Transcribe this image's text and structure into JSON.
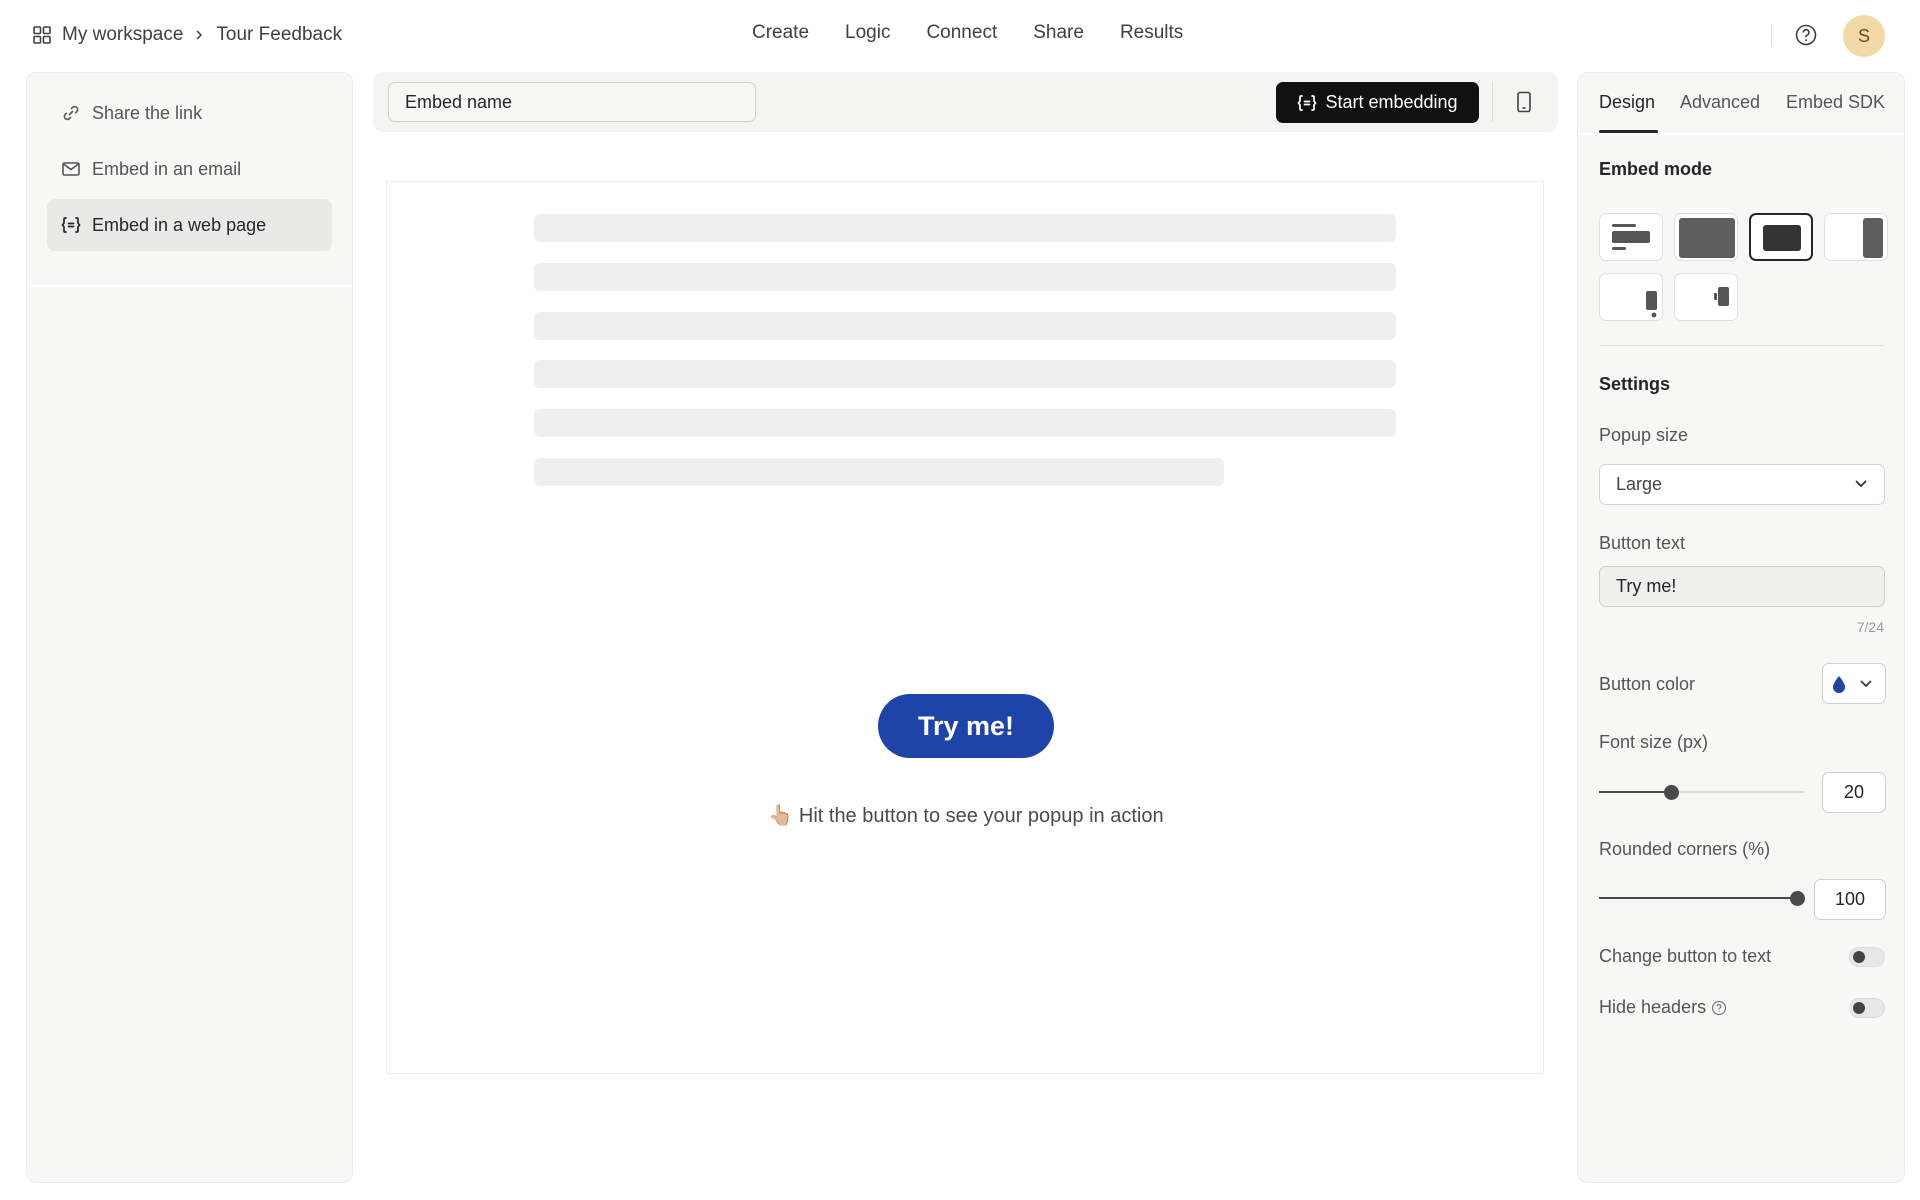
{
  "breadcrumb": {
    "workspace": "My workspace",
    "form": "Tour Feedback"
  },
  "topnav": [
    "Create",
    "Logic",
    "Connect",
    "Share",
    "Results"
  ],
  "avatar": {
    "initial": "S",
    "color": "#f3d9a7"
  },
  "left_menu": [
    {
      "label": "Share the link",
      "icon": "link-icon"
    },
    {
      "label": "Embed in an email",
      "icon": "mail-icon"
    },
    {
      "label": "Embed in a web page",
      "icon": "embed-code-icon",
      "active": true
    }
  ],
  "embed_bar": {
    "name_value": "Embed name",
    "start_label": "Start embedding",
    "device_icon": "mobile-device-icon"
  },
  "preview": {
    "button_label": "Try me!",
    "hint": "👆🏼 Hit the button to see your popup in action",
    "button_color": "#1f44a9"
  },
  "right_panel": {
    "tabs": [
      "Design",
      "Advanced",
      "Embed SDK"
    ],
    "active_tab": "Design",
    "embed_mode_heading": "Embed mode",
    "embed_modes": [
      "standard",
      "full-page",
      "popup",
      "slider",
      "popover",
      "side-tab"
    ],
    "selected_mode": "popup",
    "settings_heading": "Settings",
    "popup_size_label": "Popup size",
    "popup_size_value": "Large",
    "button_text_label": "Button text",
    "button_text_value": "Try me!",
    "button_text_counter": "7/24",
    "button_color_label": "Button color",
    "button_color_value": "#1f44a9",
    "font_size_label": "Font size (px)",
    "font_size_value": "20",
    "font_size_fraction": 0.35,
    "rounded_label": "Rounded corners (%)",
    "rounded_value": "100",
    "rounded_fraction": 1.0,
    "change_button_label": "Change button to text",
    "change_button_on": false,
    "hide_headers_label": "Hide headers",
    "hide_headers_on": false
  }
}
